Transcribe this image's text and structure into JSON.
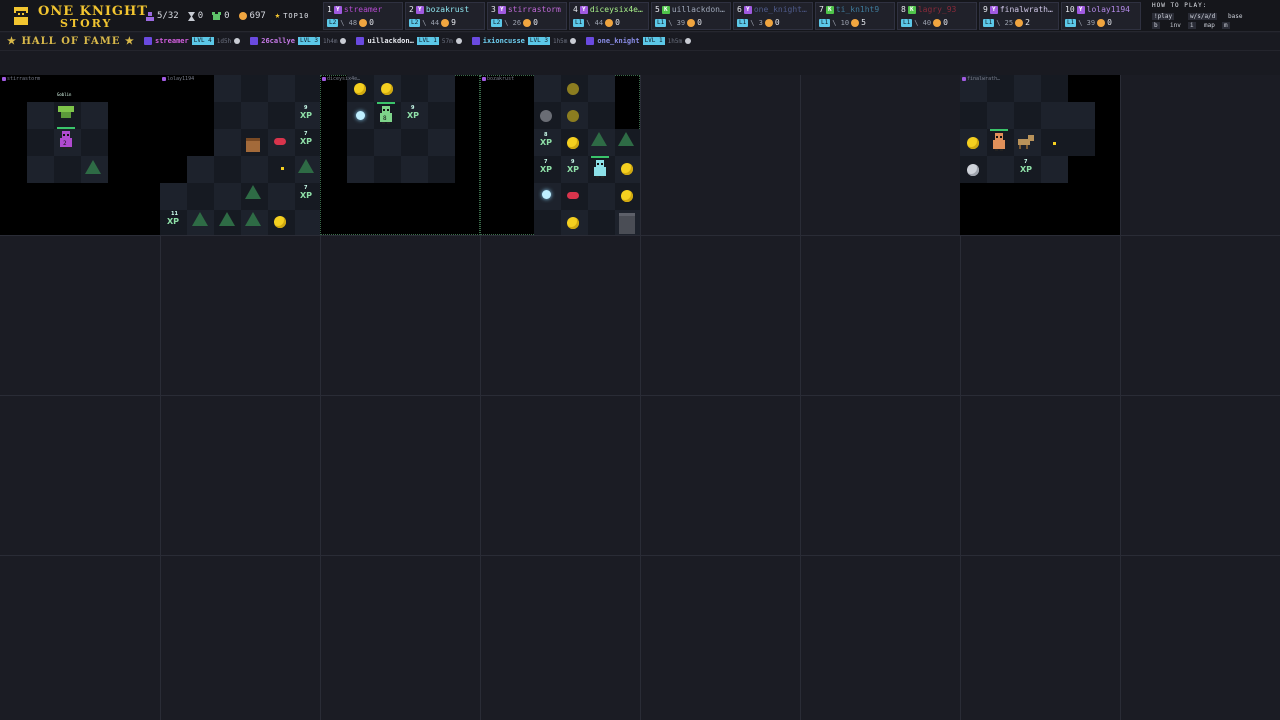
{
  "header": {
    "title_line1": "ONE KNIGHT",
    "title_line2": "STORY",
    "stats": {
      "players": "5/32",
      "hourglass": "0",
      "kills": "0",
      "gold": "697",
      "top10_label": "TOP10"
    }
  },
  "leaderboard": [
    {
      "rank": "1",
      "platform": "Y",
      "name": "streamer",
      "level": "L2",
      "swords": "\\ 48",
      "gold": "0",
      "name_color": "#b54bd0"
    },
    {
      "rank": "2",
      "platform": "Y",
      "name": "bozakrust",
      "level": "L2",
      "swords": "\\ 44",
      "gold": "9",
      "name_color": "#8fe6f0"
    },
    {
      "rank": "3",
      "platform": "Y",
      "name": "stirrastorm",
      "level": "L2",
      "swords": "\\ 26",
      "gold": "0",
      "name_color": "#c06ad8"
    },
    {
      "rank": "4",
      "platform": "Y",
      "name": "diceysix4e…",
      "level": "L1",
      "swords": "\\ 44",
      "gold": "0",
      "name_color": "#a8f08a"
    },
    {
      "rank": "5",
      "platform": "K",
      "name": "uillackdon…",
      "level": "L1",
      "swords": "\\ 39",
      "gold": "0",
      "name_color": "#9ea7b8"
    },
    {
      "rank": "6",
      "platform": "Y",
      "name": "one_knight…",
      "level": "L1",
      "swords": "\\ 3",
      "gold": "0",
      "name_color": "#4e5a8a"
    },
    {
      "rank": "7",
      "platform": "K",
      "name": "ti_kn1ht9",
      "level": "L1",
      "swords": "\\ 10",
      "gold": "5",
      "name_color": "#3e7a9a"
    },
    {
      "rank": "8",
      "platform": "K",
      "name": "lagry_93",
      "level": "L1",
      "swords": "\\ 40",
      "gold": "0",
      "name_color": "#8a2a3a"
    },
    {
      "rank": "9",
      "platform": "Y",
      "name": "finalwrath…",
      "level": "L1",
      "swords": "\\ 25",
      "gold": "2",
      "name_color": "#d0c8e8"
    },
    {
      "rank": "10",
      "platform": "Y",
      "name": "lolay1194",
      "level": "L1",
      "swords": "\\ 39",
      "gold": "0",
      "name_color": "#b48ae8"
    }
  ],
  "howto": {
    "title": "HOW TO PLAY:",
    "play": "!play",
    "move": "w/s/a/d",
    "base": "base",
    "b": "b",
    "inv": "inv",
    "i": "i",
    "map": "map",
    "m": "m"
  },
  "hall_of_fame": {
    "label": "★ HALL OF FAME ★",
    "entries": [
      {
        "name": "streamer",
        "level": "LVL 4",
        "time": "1d5h",
        "color": "#d45fe0"
      },
      {
        "name": "26callye",
        "level": "LVL 3",
        "time": "1h4m",
        "color": "#c77ae8"
      },
      {
        "name": "uillackdon…",
        "level": "LVL 1",
        "time": "57m",
        "color": "#e6e8ee"
      },
      {
        "name": "ixioncusse",
        "level": "LVL 3",
        "time": "1h5m",
        "color": "#6ecff0"
      },
      {
        "name": "one_knight",
        "level": "LVL 1",
        "time": "1h5m",
        "color": "#8a8ee8"
      }
    ]
  },
  "panels": [
    {
      "label": "stirrastorm",
      "col": 0
    },
    {
      "label": "lolay1194",
      "col": 1
    },
    {
      "label": "diceysix4e…",
      "col": 2
    },
    {
      "label": "bozakrust",
      "col": 3
    },
    {
      "label": "finalwrath…",
      "col": 6
    }
  ],
  "sprites": {
    "goblin_tag": "Goblin",
    "xp": "XP",
    "xp_nums": [
      "9",
      "7",
      "7",
      "11",
      "9",
      "8",
      "7",
      "9",
      "7"
    ],
    "hero_level": "8",
    "hero2_level": "2"
  },
  "colors": {
    "gold": "#f2c530",
    "accent_cyan": "#5cc8e8",
    "board_bg": "#1b1c24",
    "tree": "#2e6b45",
    "coin": "#f5d020"
  }
}
